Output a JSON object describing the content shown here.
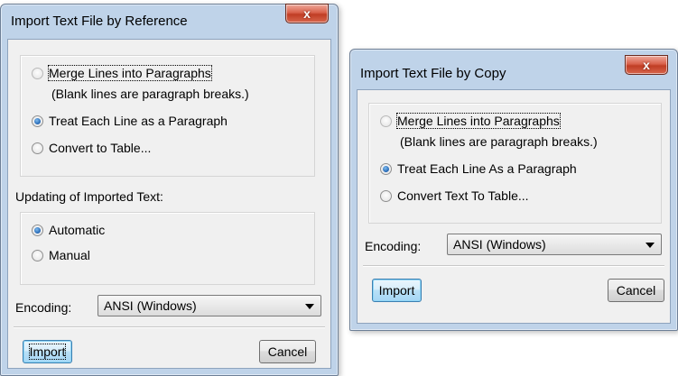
{
  "dialog_reference": {
    "title": "Import Text File by Reference",
    "close_label": "x",
    "options": [
      {
        "label": "Merge Lines into Paragraphs",
        "note": "(Blank lines are paragraph breaks.)",
        "checked": false
      },
      {
        "label": "Treat Each Line as a Paragraph",
        "checked": true
      },
      {
        "label": "Convert to Table...",
        "checked": false
      }
    ],
    "updating_label": "Updating of Imported Text:",
    "updating_options": [
      {
        "label": "Automatic",
        "checked": true
      },
      {
        "label": "Manual",
        "checked": false
      }
    ],
    "encoding_label": "Encoding:",
    "encoding_value": "ANSI (Windows)",
    "import_label": "Import",
    "cancel_label": "Cancel"
  },
  "dialog_copy": {
    "title": "Import Text File by Copy",
    "close_label": "x",
    "options": [
      {
        "label": "Merge Lines into Paragraphs",
        "note": "(Blank lines are paragraph breaks.)",
        "checked": false
      },
      {
        "label": "Treat Each Line As a Paragraph",
        "checked": true
      },
      {
        "label": "Convert Text To Table...",
        "checked": false
      }
    ],
    "encoding_label": "Encoding:",
    "encoding_value": "ANSI (Windows)",
    "import_label": "Import",
    "cancel_label": "Cancel"
  },
  "colors": {
    "frame": "#bfd3e9",
    "client": "#f0f0f0",
    "close_button": "#c03d24",
    "default_button": "#a5d6f5"
  },
  "icons": [
    "close-icon",
    "dropdown-arrow-icon",
    "radio-button"
  ]
}
